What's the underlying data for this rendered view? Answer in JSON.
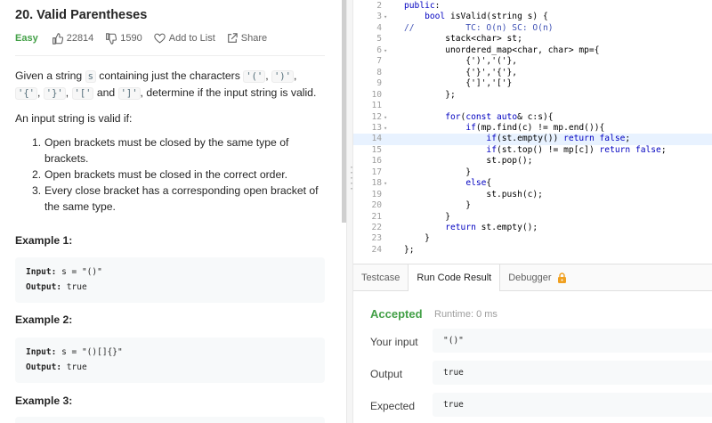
{
  "problem": {
    "title": "20. Valid Parentheses",
    "difficulty": "Easy",
    "likes": "22814",
    "dislikes": "1590",
    "add_to_list": "Add to List",
    "share": "Share",
    "desc_1a": "Given a string ",
    "desc_1_code_s": "s",
    "desc_1b": " containing just the characters ",
    "chars": [
      "'('",
      "')'",
      "'{'",
      "'}'",
      "'['",
      "']'"
    ],
    "desc_comma": ", ",
    "desc_and": " and ",
    "desc_1c": ", determine if the input string is valid.",
    "desc_2": "An input string is valid if:",
    "rules": [
      {
        "n": "1.",
        "text": "Open brackets must be closed by the same type of brackets."
      },
      {
        "n": "2.",
        "text": "Open brackets must be closed in the correct order."
      },
      {
        "n": "3.",
        "text": "Every close bracket has a corresponding open bracket of the same type."
      }
    ],
    "examples": [
      {
        "heading": "Example 1:",
        "input_label": "Input:",
        "input": "s = \"()\"",
        "output_label": "Output:",
        "output": "true"
      },
      {
        "heading": "Example 2:",
        "input_label": "Input:",
        "input": "s = \"()[]{}\"",
        "output_label": "Output:",
        "output": "true"
      },
      {
        "heading": "Example 3:"
      }
    ]
  },
  "editor": {
    "lines": [
      {
        "n": "2",
        "fold": "",
        "code": "public:"
      },
      {
        "n": "3",
        "fold": "▾",
        "code": "    bool isValid(string s) {"
      },
      {
        "n": "4",
        "fold": "",
        "code": "//          TC: O(n) SC: O(n)"
      },
      {
        "n": "5",
        "fold": "",
        "code": "        stack<char> st;"
      },
      {
        "n": "6",
        "fold": "▾",
        "code": "        unordered_map<char, char> mp={"
      },
      {
        "n": "7",
        "fold": "",
        "code": "            {')','('},"
      },
      {
        "n": "8",
        "fold": "",
        "code": "            {'}','{'},"
      },
      {
        "n": "9",
        "fold": "",
        "code": "            {']','['}"
      },
      {
        "n": "10",
        "fold": "",
        "code": "        };"
      },
      {
        "n": "11",
        "fold": "",
        "code": ""
      },
      {
        "n": "12",
        "fold": "▾",
        "code": "        for(const auto& c:s){"
      },
      {
        "n": "13",
        "fold": "▾",
        "code": "            if(mp.find(c) != mp.end()){"
      },
      {
        "n": "14",
        "fold": "",
        "code": "                if(st.empty()) return false;"
      },
      {
        "n": "15",
        "fold": "",
        "code": "                if(st.top() != mp[c]) return false;"
      },
      {
        "n": "16",
        "fold": "",
        "code": "                st.pop();"
      },
      {
        "n": "17",
        "fold": "",
        "code": "            }"
      },
      {
        "n": "18",
        "fold": "▾",
        "code": "            else{"
      },
      {
        "n": "19",
        "fold": "",
        "code": "                st.push(c);"
      },
      {
        "n": "20",
        "fold": "",
        "code": "            }"
      },
      {
        "n": "21",
        "fold": "",
        "code": "        }"
      },
      {
        "n": "22",
        "fold": "",
        "code": "        return st.empty();"
      },
      {
        "n": "23",
        "fold": "",
        "code": "    }"
      },
      {
        "n": "24",
        "fold": "",
        "code": "};"
      }
    ],
    "highlighted_line": "14"
  },
  "console": {
    "tabs": [
      "Testcase",
      "Run Code Result",
      "Debugger"
    ],
    "active_tab": "Run Code Result",
    "status": "Accepted",
    "runtime": "Runtime: 0 ms",
    "your_input_label": "Your input",
    "your_input": "\"()\"",
    "output_label": "Output",
    "output": "true",
    "expected_label": "Expected",
    "expected": "true"
  },
  "colors": {
    "accepted": "#43a047",
    "easy": "#43a047",
    "lock": "#f0a020",
    "highlight_line": "#e8f2ff"
  }
}
